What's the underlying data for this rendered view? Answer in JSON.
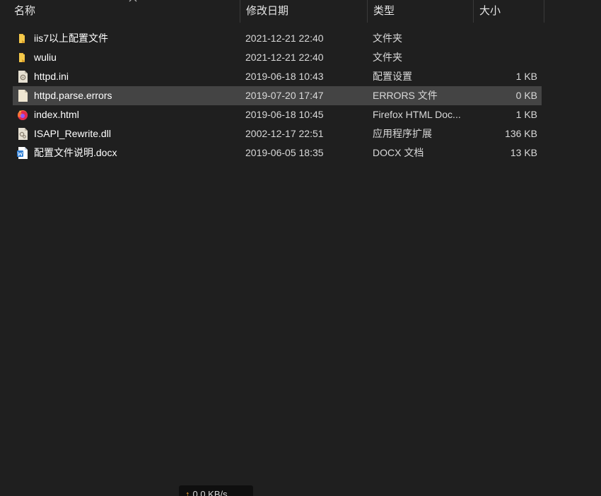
{
  "columns": {
    "name": "名称",
    "date": "修改日期",
    "type": "类型",
    "size": "大小"
  },
  "sort": {
    "column": "name",
    "icon": "chevron-up-icon"
  },
  "files": [
    {
      "name": "iis7以上配置文件",
      "date": "2021-12-21 22:40",
      "type": "文件夹",
      "size": "",
      "icon": "folder-icon",
      "selected": false
    },
    {
      "name": "wuliu",
      "date": "2021-12-21 22:40",
      "type": "文件夹",
      "size": "",
      "icon": "folder-icon",
      "selected": false
    },
    {
      "name": "httpd.ini",
      "date": "2019-06-18 10:43",
      "type": "配置设置",
      "size": "1 KB",
      "icon": "settings-file-icon",
      "selected": false
    },
    {
      "name": "httpd.parse.errors",
      "date": "2019-07-20 17:47",
      "type": "ERRORS 文件",
      "size": "0 KB",
      "icon": "generic-file-icon",
      "selected": true
    },
    {
      "name": "index.html",
      "date": "2019-06-18 10:45",
      "type": "Firefox HTML Doc...",
      "size": "1 KB",
      "icon": "firefox-icon",
      "selected": false
    },
    {
      "name": "ISAPI_Rewrite.dll",
      "date": "2002-12-17 22:51",
      "type": "应用程序扩展",
      "size": "136 KB",
      "icon": "dll-file-icon",
      "selected": false
    },
    {
      "name": "配置文件说明.docx",
      "date": "2019-06-05 18:35",
      "type": "DOCX 文档",
      "size": "13 KB",
      "icon": "word-doc-icon",
      "selected": false
    }
  ],
  "transfer": {
    "arrow": "↑",
    "speed": "0.0 KB/s"
  },
  "colors": {
    "background": "#1f1f1f",
    "selected_row": "#444444",
    "folder": "#f0c040",
    "accent": "#f0a030"
  }
}
